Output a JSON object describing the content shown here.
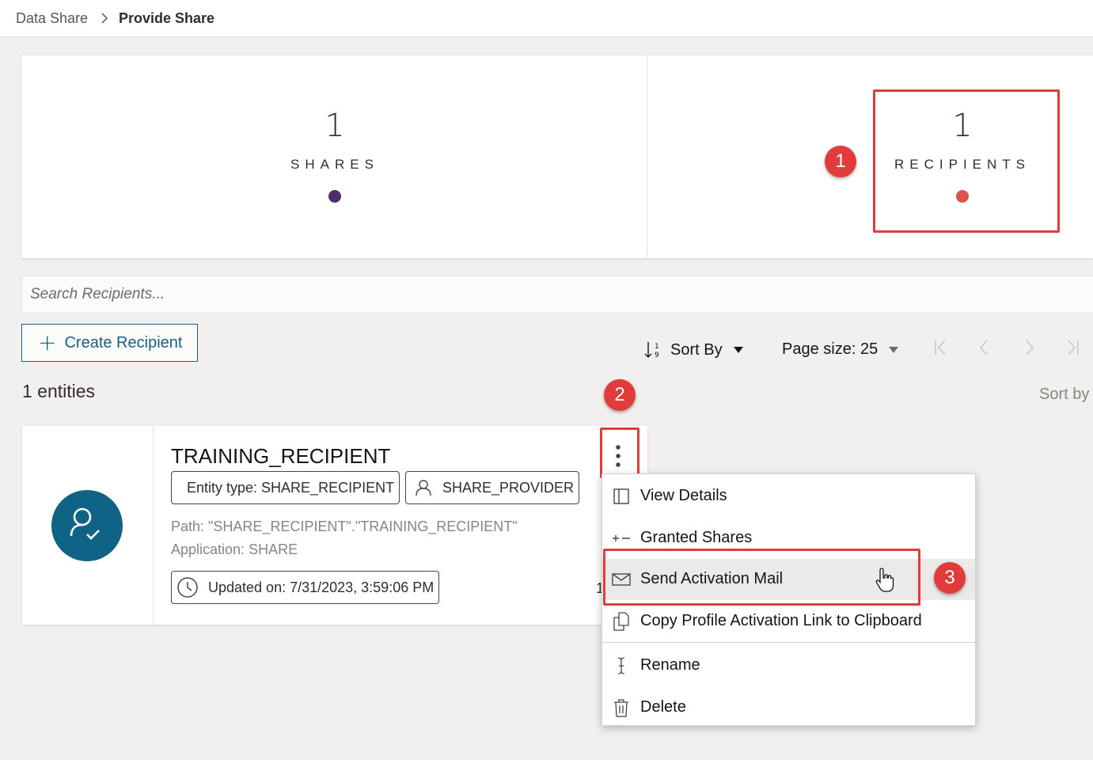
{
  "breadcrumb": {
    "items": [
      "Data Share",
      "Provide Share"
    ]
  },
  "stats": {
    "shares": {
      "count": "1",
      "label": "SHARES",
      "color": "#4c2d6e"
    },
    "recipients": {
      "count": "1",
      "label": "RECIPIENTS",
      "color": "#d9534f"
    }
  },
  "search": {
    "placeholder": "Search Recipients..."
  },
  "toolbar": {
    "create_label": "Create Recipient",
    "sort_label": "Sort By",
    "page_size_label": "Page size: 25"
  },
  "entities_count": "1 entities",
  "sort_by_right": "Sort by",
  "card": {
    "title": "TRAINING_RECIPIENT",
    "entity_type": "Entity type: SHARE_RECIPIENT",
    "owner": "SHARE_PROVIDER",
    "path": "Path: \"SHARE_RECIPIENT\".\"TRAINING_RECIPIENT\"",
    "application": "Application: SHARE",
    "updated": "Updated on: 7/31/2023, 3:59:06 PM",
    "partial_text": "1"
  },
  "menu": {
    "items": [
      {
        "label": "View Details",
        "icon": "panel-icon"
      },
      {
        "label": "Granted Shares",
        "icon": "plus-minus-icon"
      },
      {
        "label": "Send Activation Mail",
        "icon": "mail-icon"
      },
      {
        "label": "Copy Profile Activation Link to Clipboard",
        "icon": "copy-icon"
      },
      {
        "label": "Rename",
        "icon": "text-cursor-icon"
      },
      {
        "label": "Delete",
        "icon": "trash-icon"
      }
    ]
  },
  "annotations": {
    "step1": "1",
    "step2": "2",
    "step3": "3"
  },
  "colors": {
    "accent": "#1a5f84",
    "highlight": "#e23b3b",
    "avatar": "#0f6385"
  }
}
